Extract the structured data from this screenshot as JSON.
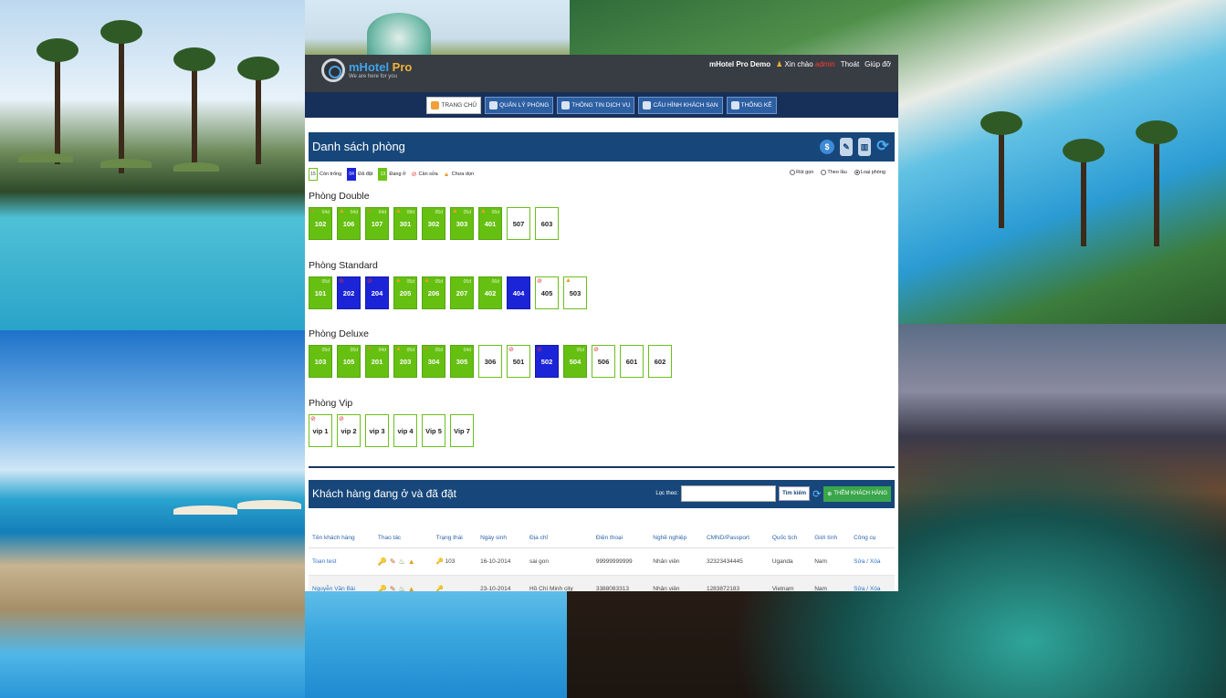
{
  "header": {
    "logo_name": "mHotel",
    "logo_name_suffix": " Pro",
    "logo_tagline": "We are here for you",
    "app_label": "mHotel Pro Demo",
    "greeting": "Xin chào",
    "user_name": "admin",
    "logout": "Thoát",
    "help": "Giúp đỡ"
  },
  "nav": {
    "items": [
      {
        "label": "TRANG CHỦ",
        "icon": "home-icon",
        "active": true
      },
      {
        "label": "QUẢN LÝ PHÒNG",
        "icon": "bed-icon",
        "active": false
      },
      {
        "label": "THÔNG TIN DỊCH VỤ",
        "icon": "document-icon",
        "active": false
      },
      {
        "label": "CẤU HÌNH KHÁCH SẠN",
        "icon": "settings-icon",
        "active": false
      },
      {
        "label": "THỐNG KÊ",
        "icon": "chart-icon",
        "active": false
      }
    ]
  },
  "rooms_section": {
    "title": "Danh sách phòng",
    "legend": {
      "empty_count": "15",
      "empty_label": "Còn trống",
      "booked_count": "04",
      "booked_label": "Đã đặt",
      "occupied_count": "13",
      "occupied_label": "Đang ở",
      "repair_label": "Cần sửa",
      "unclean_label": "Chưa dọn"
    },
    "view_options": [
      {
        "label": "Rút gọn",
        "selected": false
      },
      {
        "label": "Theo lầu",
        "selected": false
      },
      {
        "label": "Loại phòng",
        "selected": true
      }
    ],
    "colors": {
      "occupied": "#66c012",
      "booked": "#1c24d8",
      "empty": "#ffffff",
      "header": "#17477a"
    },
    "groups": [
      {
        "name": "Phòng Double",
        "rooms": [
          {
            "no": "102",
            "state": "occupied",
            "days": "04d",
            "mark": "bag"
          },
          {
            "no": "106",
            "state": "occupied",
            "days": "04d",
            "mark": "clean"
          },
          {
            "no": "107",
            "state": "occupied",
            "days": "04d",
            "mark": "bag"
          },
          {
            "no": "301",
            "state": "occupied",
            "days": "08d",
            "mark": "clean"
          },
          {
            "no": "302",
            "state": "occupied",
            "days": "05d",
            "mark": ""
          },
          {
            "no": "303",
            "state": "occupied",
            "days": "05d",
            "mark": "clean"
          },
          {
            "no": "401",
            "state": "occupied",
            "days": "06d",
            "mark": "clean"
          },
          {
            "no": "507",
            "state": "empty",
            "days": "",
            "mark": ""
          },
          {
            "no": "603",
            "state": "empty",
            "days": "",
            "mark": ""
          }
        ]
      },
      {
        "name": "Phòng Standard",
        "rooms": [
          {
            "no": "101",
            "state": "occupied",
            "days": "05d",
            "mark": ""
          },
          {
            "no": "202",
            "state": "booked",
            "days": "",
            "mark": "fix"
          },
          {
            "no": "204",
            "state": "booked",
            "days": "",
            "mark": "fix"
          },
          {
            "no": "205",
            "state": "occupied",
            "days": "05d",
            "mark": "clean"
          },
          {
            "no": "206",
            "state": "occupied",
            "days": "05d",
            "mark": "clean"
          },
          {
            "no": "207",
            "state": "occupied",
            "days": "05d",
            "mark": ""
          },
          {
            "no": "402",
            "state": "occupied",
            "days": "06d",
            "mark": ""
          },
          {
            "no": "404",
            "state": "booked",
            "days": "",
            "mark": ""
          },
          {
            "no": "405",
            "state": "empty",
            "days": "",
            "mark": "fix"
          },
          {
            "no": "503",
            "state": "empty",
            "days": "",
            "mark": "clean"
          }
        ]
      },
      {
        "name": "Phòng Deluxe",
        "rooms": [
          {
            "no": "103",
            "state": "occupied",
            "days": "05d",
            "mark": ""
          },
          {
            "no": "105",
            "state": "occupied",
            "days": "05d",
            "mark": ""
          },
          {
            "no": "201",
            "state": "occupied",
            "days": "04d",
            "mark": "bag"
          },
          {
            "no": "203",
            "state": "occupied",
            "days": "05d",
            "mark": "clean"
          },
          {
            "no": "304",
            "state": "occupied",
            "days": "05d",
            "mark": "bag"
          },
          {
            "no": "305",
            "state": "occupied",
            "days": "04d",
            "mark": ""
          },
          {
            "no": "306",
            "state": "empty",
            "days": "",
            "mark": ""
          },
          {
            "no": "501",
            "state": "empty",
            "days": "",
            "mark": "fix"
          },
          {
            "no": "502",
            "state": "booked",
            "days": "",
            "mark": "fix"
          },
          {
            "no": "504",
            "state": "occupied",
            "days": "05d",
            "mark": ""
          },
          {
            "no": "506",
            "state": "empty",
            "days": "",
            "mark": "fix"
          },
          {
            "no": "601",
            "state": "empty",
            "days": "",
            "mark": ""
          },
          {
            "no": "602",
            "state": "empty",
            "days": "",
            "mark": ""
          }
        ]
      },
      {
        "name": "Phòng Vip",
        "rooms": [
          {
            "no": "vip 1",
            "state": "empty",
            "days": "",
            "mark": "fix"
          },
          {
            "no": "vip 2",
            "state": "empty",
            "days": "",
            "mark": "fix"
          },
          {
            "no": "vip 3",
            "state": "empty",
            "days": "",
            "mark": ""
          },
          {
            "no": "vip 4",
            "state": "empty",
            "days": "",
            "mark": ""
          },
          {
            "no": "Vip 5",
            "state": "empty",
            "days": "",
            "mark": ""
          },
          {
            "no": "Vip 7",
            "state": "empty",
            "days": "",
            "mark": ""
          }
        ]
      }
    ]
  },
  "customers_section": {
    "title": "Khách hàng đang ở và đã đặt",
    "filter_label": "Lọc theo:",
    "filter_value": "",
    "search_button": "Tìm kiếm",
    "add_button": "THÊM KHÁCH HÀNG",
    "columns": [
      "Tên khách hàng",
      "Thao tác",
      "Trạng thái",
      "Ngày sinh",
      "Địa chỉ",
      "Điện thoại",
      "Nghề nghiệp",
      "CMND/Passport",
      "Quốc tịch",
      "Giới tính",
      "Công cụ"
    ],
    "rows": [
      {
        "name": "Toan test",
        "status": "103",
        "dob": "16-10-2014",
        "address": "sai gon",
        "phone": "99999999999",
        "job": "Nhân viên",
        "id": "32323434445",
        "country": "Uganda",
        "gender": "Nam",
        "tools": "Sửa / Xóa"
      },
      {
        "name": "Nguyễn Văn Bài",
        "status": "",
        "dob": "23-10-2014",
        "address": "Hồ Chí Minh city",
        "phone": "3388083313",
        "job": "Nhân viên",
        "id": "1283872183",
        "country": "Vietnam",
        "gender": "Nam",
        "tools": "Sửa / Xóa"
      }
    ]
  }
}
